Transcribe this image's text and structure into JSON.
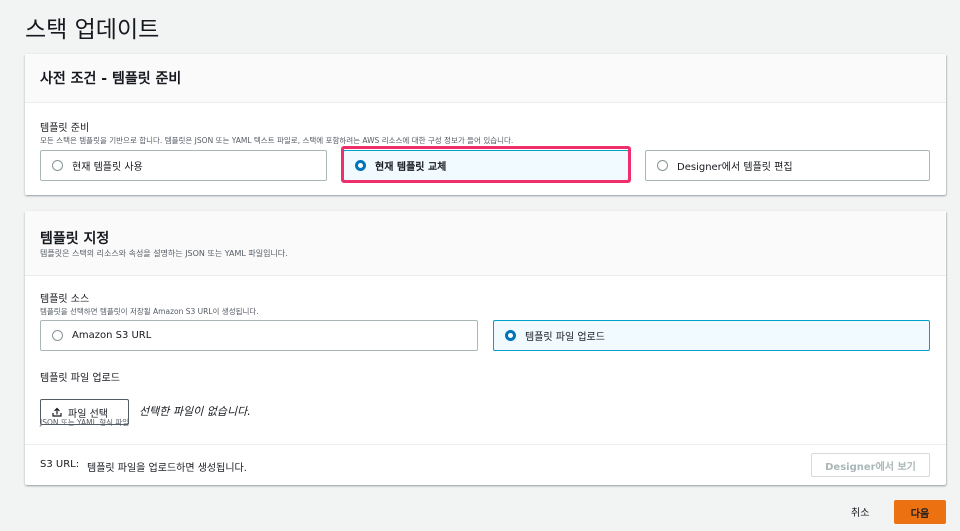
{
  "page": {
    "title": "스택 업데이트"
  },
  "prereq": {
    "title": "사전 조건 - 템플릿 준비",
    "field_label": "템플릿 준비",
    "field_desc": "모든 스택은 템플릿을 기반으로 합니다. 템플릿은 JSON 또는 YAML 텍스트 파일로, 스택에 포함하려는 AWS 리소스에 대한 구성 정보가 들어 있습니다.",
    "options": [
      {
        "label": "현재 템플릿 사용",
        "selected": false
      },
      {
        "label": "현재 템플릿 교체",
        "selected": true
      },
      {
        "label": "Designer에서 템플릿 편집",
        "selected": false
      }
    ],
    "highlight_color": "#ef2f6c"
  },
  "spec": {
    "title": "템플릿 지정",
    "desc": "템플릿은 스택의 리소스와 속성을 설명하는 JSON 또는 YAML 파일입니다.",
    "source_label": "템플릿 소스",
    "source_desc": "템플릿을 선택하면 템플릿이 저장될 Amazon S3 URL이 생성됩니다.",
    "source_options": [
      {
        "label": "Amazon S3 URL",
        "selected": false
      },
      {
        "label": "템플릿 파일 업로드",
        "selected": true
      }
    ],
    "upload_label": "템플릿 파일 업로드",
    "choose_file_label": "파일 선택",
    "choose_file_icon": "upload-icon",
    "no_file_text": "선택한 파일이 없습니다.",
    "upload_hint": "JSON 또는 YAML 형식 파일",
    "s3_label": "S3 URL:",
    "s3_value": "템플릿 파일을 업로드하면 생성됩니다.",
    "designer_button": "Designer에서 보기"
  },
  "footer": {
    "cancel": "취소",
    "next": "다음",
    "accent_color": "#ec7211"
  }
}
